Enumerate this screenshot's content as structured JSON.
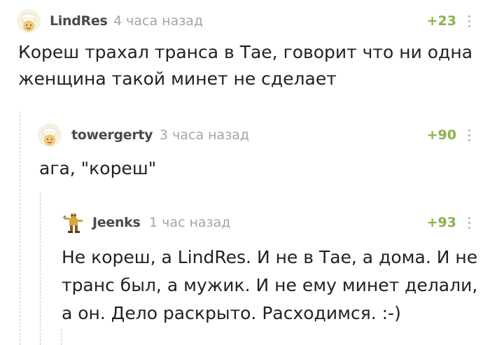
{
  "comments": [
    {
      "username": "LindRes",
      "time": "4 часа назад",
      "rating": "+23",
      "avatar_icon": "default-chef-avatar",
      "lines": [
        "Кореш трахал транса в Тае, говорит что ни одна",
        "женщина такой минет не сделает"
      ]
    },
    {
      "username": "towergerty",
      "time": "3 часа назад",
      "rating": "+90",
      "avatar_icon": "default-chef-avatar",
      "lines": [
        "ага, \"кореш\""
      ]
    },
    {
      "username": "Jeenks",
      "time": "1 час назад",
      "rating": "+93",
      "avatar_icon": "pixel-character-avatar",
      "lines": [
        "Не кореш, а LindRes. И не в Тае, а дома. И не",
        "транс был, а мужик. И не ему минет делали,",
        "а он. Дело раскрыто. Расходимся. :-)"
      ]
    }
  ],
  "colors": {
    "rating": "#8ab24a",
    "username": "#4a4a4a",
    "time": "#a5a5a5",
    "text": "#222222",
    "thread_line": "#c8c8c8"
  }
}
